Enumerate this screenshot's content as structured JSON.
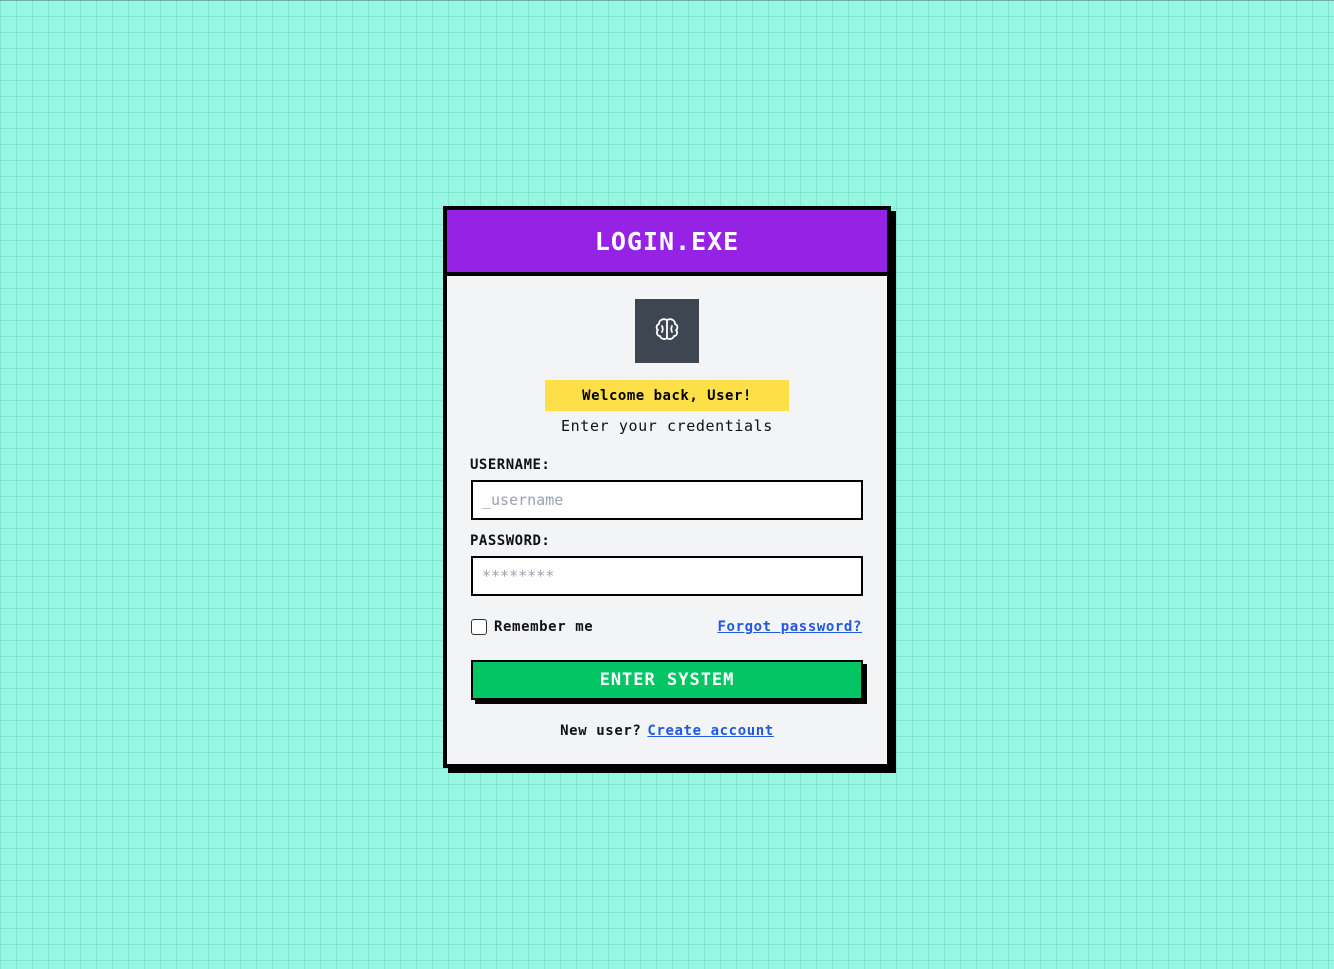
{
  "window": {
    "title": "LOGIN.EXE"
  },
  "header": {
    "logo_icon": "brain-icon",
    "welcome": "Welcome back, User!",
    "subtitle": "Enter your credentials"
  },
  "form": {
    "username_label": "USERNAME:",
    "username_placeholder": "_username",
    "username_value": "",
    "password_label": "PASSWORD:",
    "password_placeholder": "********",
    "password_value": "",
    "remember_label": "Remember me",
    "remember_checked": false,
    "forgot_link": "Forgot password?",
    "submit_label": "ENTER SYSTEM"
  },
  "footer": {
    "prompt": "New user?",
    "create_link": "Create account"
  },
  "colors": {
    "background": "#96f7e2",
    "titlebar": "#9622e6",
    "badge": "#fde047",
    "button": "#02c563",
    "link": "#2158e0",
    "logo_tile": "#3d4651"
  }
}
